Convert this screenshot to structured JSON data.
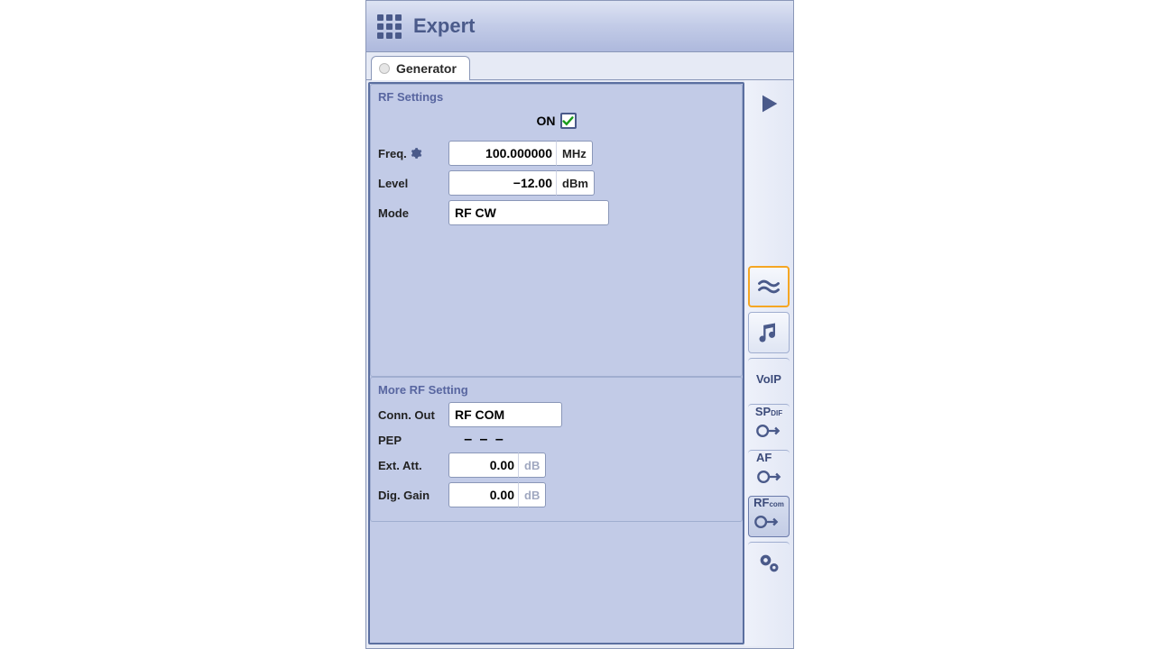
{
  "window": {
    "title": "Expert"
  },
  "tabs": {
    "active": "Generator"
  },
  "rf_settings": {
    "title": "RF Settings",
    "on_label": "ON",
    "on_checked": true,
    "freq_label": "Freq.",
    "freq_value": "100.000000",
    "freq_unit": "MHz",
    "level_label": "Level",
    "level_value": "−12.00",
    "level_unit": "dBm",
    "mode_label": "Mode",
    "mode_value": "RF CW"
  },
  "more_rf": {
    "title": "More RF Setting",
    "conn_label": "Conn. Out",
    "conn_value": "RF COM",
    "pep_label": "PEP",
    "pep_value": "– – –",
    "extatt_label": "Ext. Att.",
    "extatt_value": "0.00",
    "extatt_unit": "dB",
    "diggain_label": "Dig. Gain",
    "diggain_value": "0.00",
    "diggain_unit": "dB"
  },
  "toolbar": {
    "play": "Play",
    "approx": "Approx",
    "music": "Music",
    "voip": "VoIP",
    "sp": "SP",
    "af": "AF",
    "rf": "RF"
  }
}
